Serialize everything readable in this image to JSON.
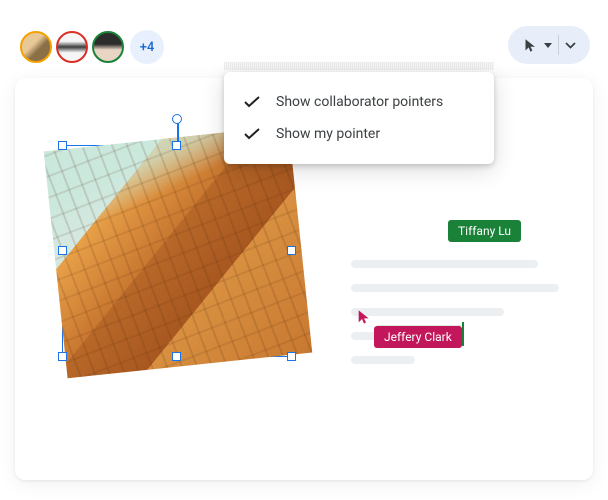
{
  "avatars": {
    "overflow_label": "+4"
  },
  "menu": {
    "item1": "Show collaborator pointers",
    "item2": "Show my pointer"
  },
  "collaborators": {
    "green": {
      "name": "Tiffany Lu",
      "color": "#1a8238"
    },
    "magenta": {
      "name": "Jeffery Clark",
      "color": "#c2185b"
    }
  }
}
